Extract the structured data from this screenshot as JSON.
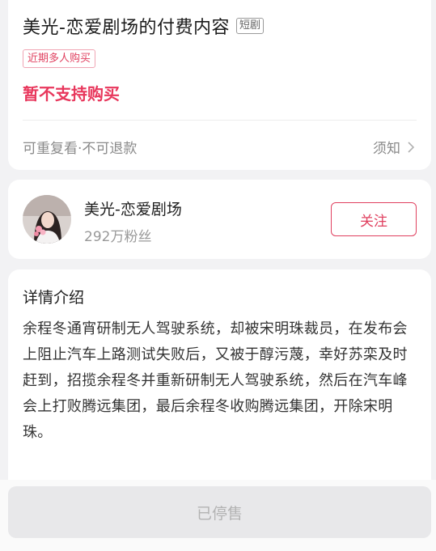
{
  "product": {
    "title": "美光-恋爱剧场的付费内容",
    "type_tag": "短剧",
    "hot_tag": "近期多人购买",
    "purchase_status": "暂不支持购买",
    "policy": "可重复看·不可退款",
    "notice_label": "须知"
  },
  "author": {
    "name": "美光-恋爱剧场",
    "fans": "292万粉丝",
    "follow_label": "关注"
  },
  "detail": {
    "heading": "详情介绍",
    "body": "余程冬通宵研制无人驾驶系统，却被宋明珠裁员，在发布会上阻止汽车上路测试失败后，又被于醇污蔑，幸好苏栾及时赶到，招揽余程冬并重新研制无人驾驶系统，然后在汽车峰会上打败腾远集团，最后余程冬收购腾远集团，开除宋明珠。"
  },
  "bottom": {
    "status_button": "已停售"
  },
  "colors": {
    "accent": "#e0405f",
    "price_red": "#e8375c",
    "page_bg": "#f2f2f4"
  }
}
